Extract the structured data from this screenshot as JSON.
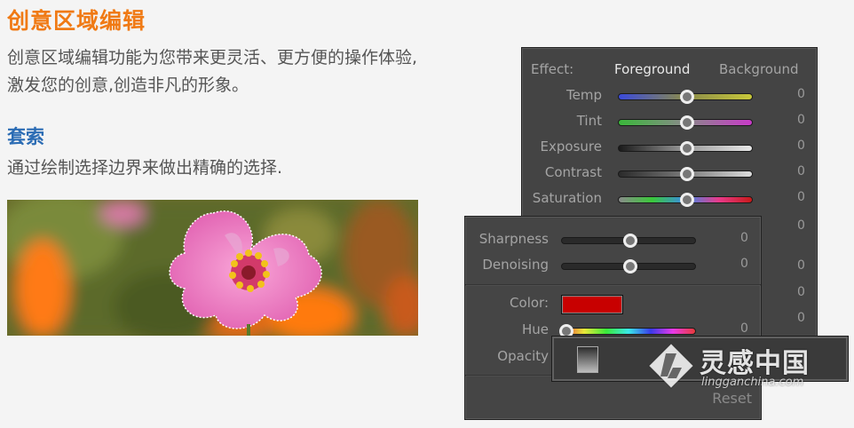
{
  "heading": "创意区域编辑",
  "description": "创意区域编辑功能为您带来更灵活、更方便的操作体验,激发您的创意,创造非凡的形象。",
  "subheading": "套索",
  "subdescription": "通过绘制选择边界来做出精确的选择.",
  "panel_back": {
    "effect_label": "Effect:",
    "effect_foreground": "Foreground",
    "effect_background": "Background",
    "sliders": [
      {
        "label": "Temp",
        "value": "0"
      },
      {
        "label": "Tint",
        "value": "0"
      },
      {
        "label": "Exposure",
        "value": "0"
      },
      {
        "label": "Contrast",
        "value": "0"
      },
      {
        "label": "Saturation",
        "value": "0"
      }
    ],
    "extra_values": [
      "0",
      "0",
      "0",
      "0"
    ]
  },
  "panel_front": {
    "sliders": [
      {
        "label": "Sharpness",
        "value": "0"
      },
      {
        "label": "Denoising",
        "value": "0"
      }
    ],
    "color_label": "Color:",
    "color_value": "#c80000",
    "hue_label": "Hue",
    "hue_value": "0",
    "opacity_label": "Opacity",
    "reset_label": "Reset"
  },
  "watermark": {
    "text": "灵感中国",
    "url": "lingganchina.com"
  },
  "colors": {
    "heading": "#f07a14",
    "subheading": "#2b6cb4"
  }
}
